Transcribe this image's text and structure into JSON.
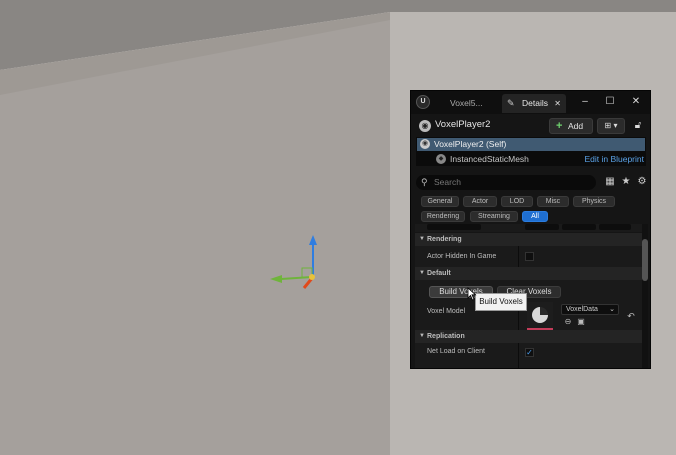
{
  "viewport": {
    "background_colors": {
      "floor": "#b9b5b1",
      "wall": "#a6a19d",
      "ceiling": "#898683"
    },
    "gizmo_colors": {
      "z_axis": "#2f7de0",
      "x_axis": "#e04a1b",
      "y_axis": "#6fb43b"
    }
  },
  "window": {
    "logo": "ue-logo-icon",
    "tab_inactive": "Voxel5...",
    "tab_active": "Details",
    "controls": {
      "minimize": "–",
      "maximize": "☐",
      "close": "✕"
    }
  },
  "actor": {
    "name": "VoxelPlayer2",
    "add_label": "Add",
    "blueprint_icon": "blueprint-options-icon",
    "lock_icon": "lock-icon"
  },
  "components": {
    "root_label": "VoxelPlayer2 (Self)",
    "child_label": "InstancedStaticMesh",
    "edit_link": "Edit in Blueprint"
  },
  "search": {
    "placeholder": "Search"
  },
  "filters": {
    "general": "General",
    "actor": "Actor",
    "lod": "LOD",
    "misc": "Misc",
    "physics": "Physics",
    "rendering": "Rendering",
    "streaming": "Streaming",
    "all": "All",
    "active": "All"
  },
  "sections": {
    "rendering": {
      "title": "Rendering",
      "prop_label": "Actor Hidden In Game",
      "checked": false
    },
    "default": {
      "title": "Default",
      "build_label": "Build Voxels",
      "clear_label": "Clear Voxels",
      "model_label": "Voxel Model",
      "model_value": "VoxelData"
    },
    "replication": {
      "title": "Replication",
      "prop_label": "Net Load on Client",
      "checked": true
    }
  },
  "tooltip": {
    "text": "Build Voxels"
  },
  "colors": {
    "accent": "#1f6fd1",
    "selection": "#405a72",
    "link": "#5ba3e8",
    "thumbnail_bar": "#c43c5a"
  }
}
